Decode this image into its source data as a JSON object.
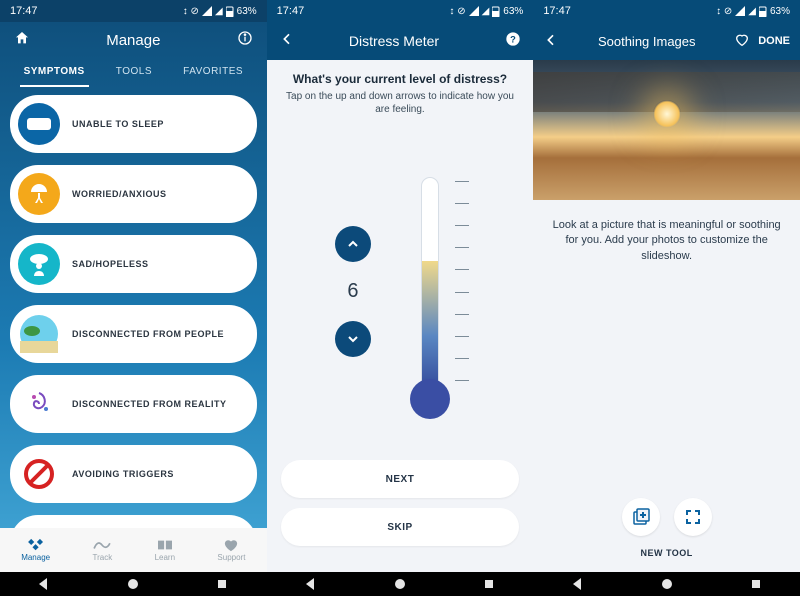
{
  "status": {
    "time": "17:47",
    "battery": "63%",
    "icons": "↕ ⊘ ▲ ◢"
  },
  "screenA": {
    "title": "Manage",
    "tabs": [
      "SYMPTOMS",
      "TOOLS",
      "FAVORITES"
    ],
    "activeTab": 0,
    "items": [
      {
        "label": "UNABLE TO SLEEP",
        "icon": "pillow",
        "bg": "#0b66a6"
      },
      {
        "label": "WORRIED/ANXIOUS",
        "icon": "umbrella-person",
        "bg": "#f4a81a"
      },
      {
        "label": "SAD/HOPELESS",
        "icon": "cloud-person",
        "bg": "#15b6c9"
      },
      {
        "label": "DISCONNECTED FROM PEOPLE",
        "icon": "beach",
        "bg": "#7fd977"
      },
      {
        "label": "DISCONNECTED FROM REALITY",
        "icon": "swirl",
        "bg": "#ffffff"
      },
      {
        "label": "AVOIDING TRIGGERS",
        "icon": "no-sign",
        "bg": "#ffffff"
      }
    ],
    "bottomNav": [
      {
        "label": "Manage",
        "icon": "diamond-grid",
        "active": true
      },
      {
        "label": "Track",
        "icon": "wave",
        "active": false
      },
      {
        "label": "Learn",
        "icon": "book",
        "active": false
      },
      {
        "label": "Support",
        "icon": "heart",
        "active": false
      }
    ]
  },
  "screenB": {
    "title": "Distress Meter",
    "question": "What's your current level of distress?",
    "subtitle": "Tap on the up and down arrows to indicate how you are feeling.",
    "value": "6",
    "next": "NEXT",
    "skip": "SKIP"
  },
  "screenC": {
    "title": "Soothing Images",
    "done": "DONE",
    "body": "Look at a picture that is meaningful or soothing for you. Add your photos to customize the slideshow.",
    "newTool": "NEW TOOL"
  }
}
